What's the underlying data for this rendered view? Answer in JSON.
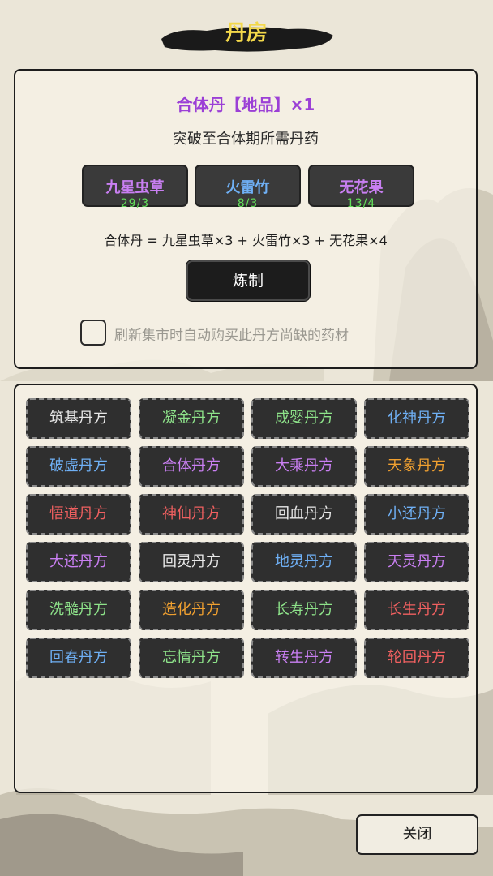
{
  "title": "丹房",
  "recipe": {
    "title": "合体丹【地品】×1",
    "title_color": "#9b3fd6",
    "description": "突破至合体期所需丹药",
    "ingredients": [
      {
        "name": "九星虫草",
        "count": "29/3",
        "color": "#c97ff2"
      },
      {
        "name": "火雷竹",
        "count": "8/3",
        "color": "#6fb0f5"
      },
      {
        "name": "无花果",
        "count": "13/4",
        "color": "#c97ff2"
      }
    ],
    "formula": "合体丹 = 九星虫草×3 + 火雷竹×3 + 无花果×4",
    "refine_label": "炼制",
    "auto_buy_label": "刷新集市时自动购买此丹方尚缺的药材",
    "auto_buy_checked": false
  },
  "recipes": [
    {
      "label": "筑基丹方",
      "color": "#e8e8e8"
    },
    {
      "label": "凝金丹方",
      "color": "#8ee38a"
    },
    {
      "label": "成婴丹方",
      "color": "#8ee38a"
    },
    {
      "label": "化神丹方",
      "color": "#6fb0f5"
    },
    {
      "label": "破虚丹方",
      "color": "#6fb0f5"
    },
    {
      "label": "合体丹方",
      "color": "#c97ff2"
    },
    {
      "label": "大乘丹方",
      "color": "#c97ff2"
    },
    {
      "label": "天象丹方",
      "color": "#f0a030"
    },
    {
      "label": "悟道丹方",
      "color": "#f06060"
    },
    {
      "label": "神仙丹方",
      "color": "#f06060"
    },
    {
      "label": "回血丹方",
      "color": "#e8e8e8"
    },
    {
      "label": "小还丹方",
      "color": "#6fb0f5"
    },
    {
      "label": "大还丹方",
      "color": "#c97ff2"
    },
    {
      "label": "回灵丹方",
      "color": "#e8e8e8"
    },
    {
      "label": "地灵丹方",
      "color": "#6fb0f5"
    },
    {
      "label": "天灵丹方",
      "color": "#c97ff2"
    },
    {
      "label": "洗髓丹方",
      "color": "#8ee38a"
    },
    {
      "label": "造化丹方",
      "color": "#f0a030"
    },
    {
      "label": "长寿丹方",
      "color": "#8ee38a"
    },
    {
      "label": "长生丹方",
      "color": "#f06060"
    },
    {
      "label": "回春丹方",
      "color": "#6fb0f5"
    },
    {
      "label": "忘情丹方",
      "color": "#8ee38a"
    },
    {
      "label": "转生丹方",
      "color": "#c97ff2"
    },
    {
      "label": "轮回丹方",
      "color": "#f06060"
    }
  ],
  "close_label": "关闭"
}
